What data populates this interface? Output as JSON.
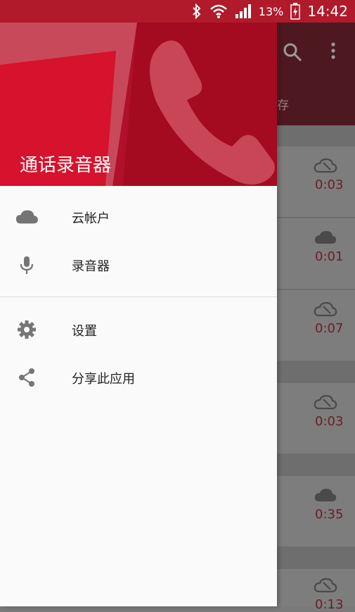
{
  "status_bar": {
    "battery": "13%",
    "time": "14:42"
  },
  "drawer": {
    "title": "通话录音器",
    "items": [
      {
        "icon": "cloud-icon",
        "label": "云帐户"
      },
      {
        "icon": "mic-icon",
        "label": "录音器"
      },
      {
        "icon": "gear-icon",
        "label": "设置"
      },
      {
        "icon": "share-icon",
        "label": "分享此应用"
      }
    ]
  },
  "background": {
    "tab_fragment": "存",
    "recordings": [
      {
        "icon": "cloud-off-icon",
        "duration": "0:03"
      },
      {
        "icon": "cloud-icon",
        "duration": "0:01"
      },
      {
        "icon": "cloud-off-icon",
        "duration": "0:07"
      },
      {
        "icon": "cloud-off-icon",
        "duration": "0:03"
      },
      {
        "icon": "cloud-icon",
        "duration": "0:35"
      },
      {
        "icon": "cloud-off-icon",
        "duration": "0:13"
      }
    ]
  },
  "colors": {
    "status_bar": "#b01a2b",
    "header_red": "#a01020",
    "drawer_bg": "#fafafa"
  }
}
